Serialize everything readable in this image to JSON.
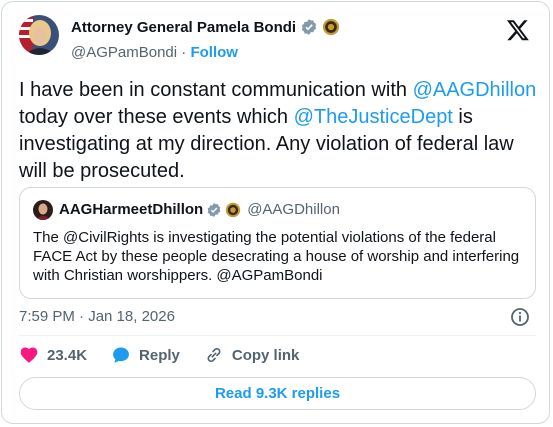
{
  "author": {
    "name": "Attorney General Pamela Bondi",
    "handle": "@AGPamBondi",
    "separator": "·",
    "follow_label": "Follow"
  },
  "tweet": {
    "parts": [
      {
        "text": "I have been in constant communication with ",
        "type": "text"
      },
      {
        "text": "@AAGDhillon",
        "type": "mention"
      },
      {
        "text": " today over these events which ",
        "type": "text"
      },
      {
        "text": "@TheJusticeDept",
        "type": "mention"
      },
      {
        "text": " is investigating at my direction. Any violation of federal law will be prosecuted.",
        "type": "text"
      }
    ]
  },
  "quote": {
    "name": "AAGHarmeetDhillon",
    "handle": "@AAGDhillon",
    "text": "The @CivilRights is investigating the potential violations of the federal FACE Act by these people desecrating a house of worship and interfering with Christian worshippers.  @AGPamBondi"
  },
  "timestamp": "7:59 PM · Jan 18, 2026",
  "actions": {
    "likes_count": "23.4K",
    "reply_label": "Reply",
    "copy_link_label": "Copy link"
  },
  "read_replies_label": "Read 9.3K replies",
  "icons": {
    "x_logo": "x-logo-icon",
    "verified": "verified-badge-icon",
    "seal": "government-seal-icon",
    "info": "info-icon",
    "heart": "heart-icon",
    "reply": "reply-bubble-icon",
    "link": "link-icon"
  },
  "colors": {
    "accent": "#1d9bf0",
    "like": "#f91880",
    "secondary_text": "#536471",
    "border": "#cfd9de",
    "verified_gray": "#829aab"
  }
}
